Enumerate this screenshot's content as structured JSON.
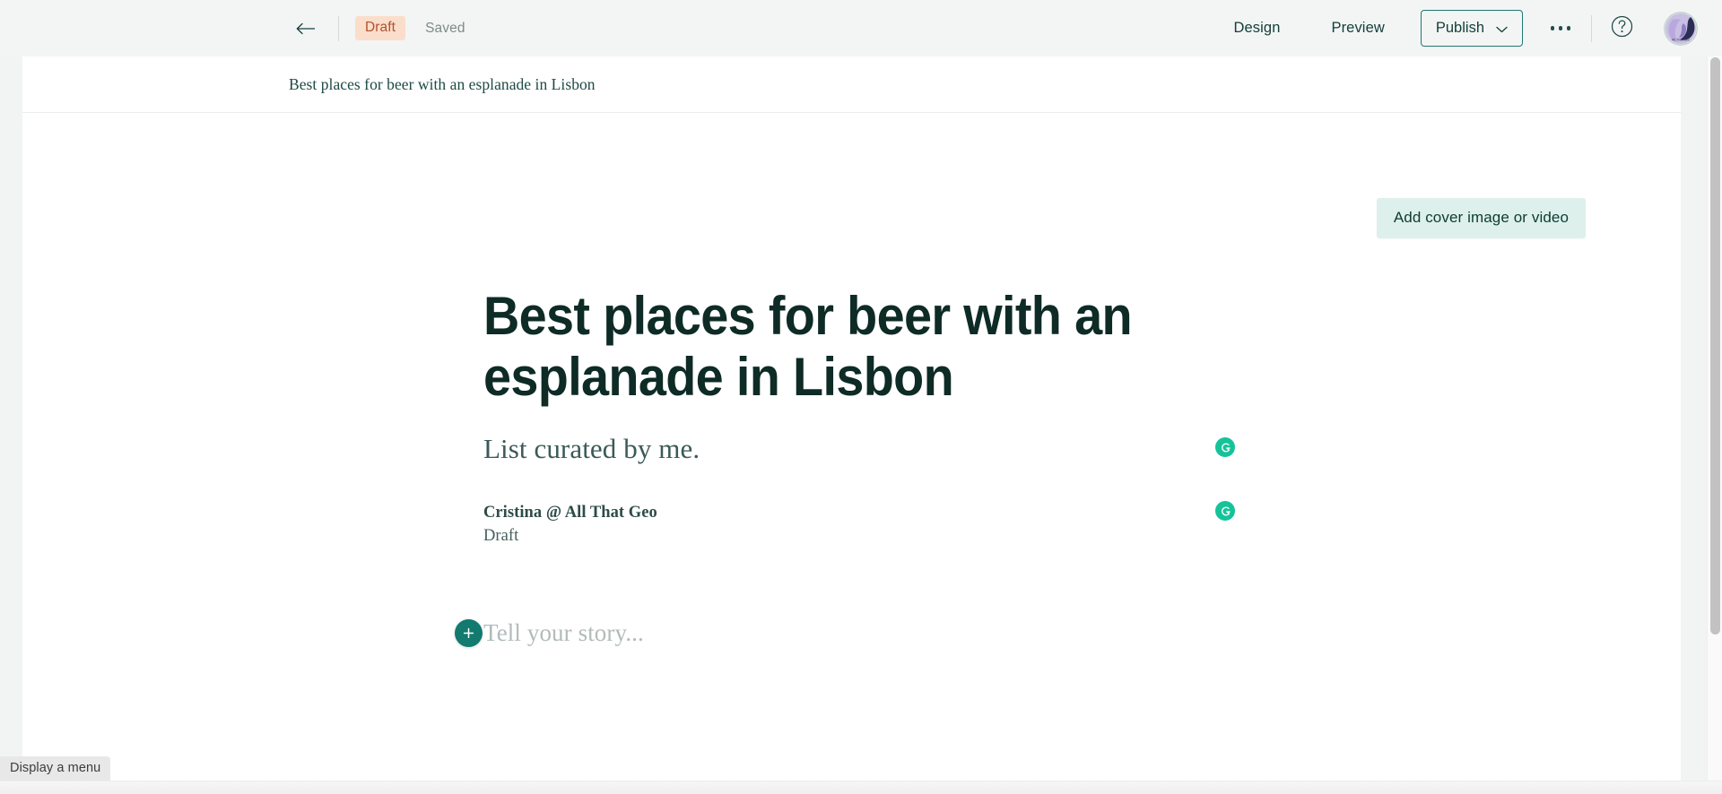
{
  "app_bar": {
    "back_icon": "back-arrow-icon",
    "status_badge": "Draft",
    "saved_label": "Saved",
    "design_label": "Design",
    "preview_label": "Preview",
    "publish_label": "Publish",
    "publish_chevron_icon": "chevron-down-icon",
    "more_icon": "ellipsis-icon",
    "help_icon": "question-mark-circle-icon",
    "avatar_icon": "user-avatar-logo",
    "avatar_caption": "All That Geo",
    "colors": {
      "bar_background": "#f3f5f4",
      "draft_badge_bg": "#fbddcb",
      "draft_badge_text": "#b0532b",
      "publish_border": "#1d7a70",
      "nav_text": "#13403b"
    }
  },
  "editor": {
    "breadcrumb_title": "Best places for beer with an esplanade in Lisbon",
    "cover_button_label": "Add cover image or video",
    "cover_button_bg": "#def0eb",
    "document": {
      "title": "Best places for beer with an esplanade in Lisbon",
      "subtitle": "List curated by me.",
      "author": "Cristina @ All That Geo",
      "status": "Draft",
      "body_placeholder": "Tell your story...",
      "add_block_icon": "plus-icon",
      "title_color": "#0e2b26",
      "subtitle_color": "#3b5a57"
    },
    "grammarly": {
      "icon": "grammarly-g-icon",
      "color": "#15c39a",
      "count": 2
    }
  },
  "status_bar": {
    "tooltip": "Display a menu"
  },
  "scrollbars": {
    "vertical_thumb_icon": "vertical-scrollbar-thumb",
    "horizontal_track_icon": "horizontal-scrollbar-track"
  }
}
